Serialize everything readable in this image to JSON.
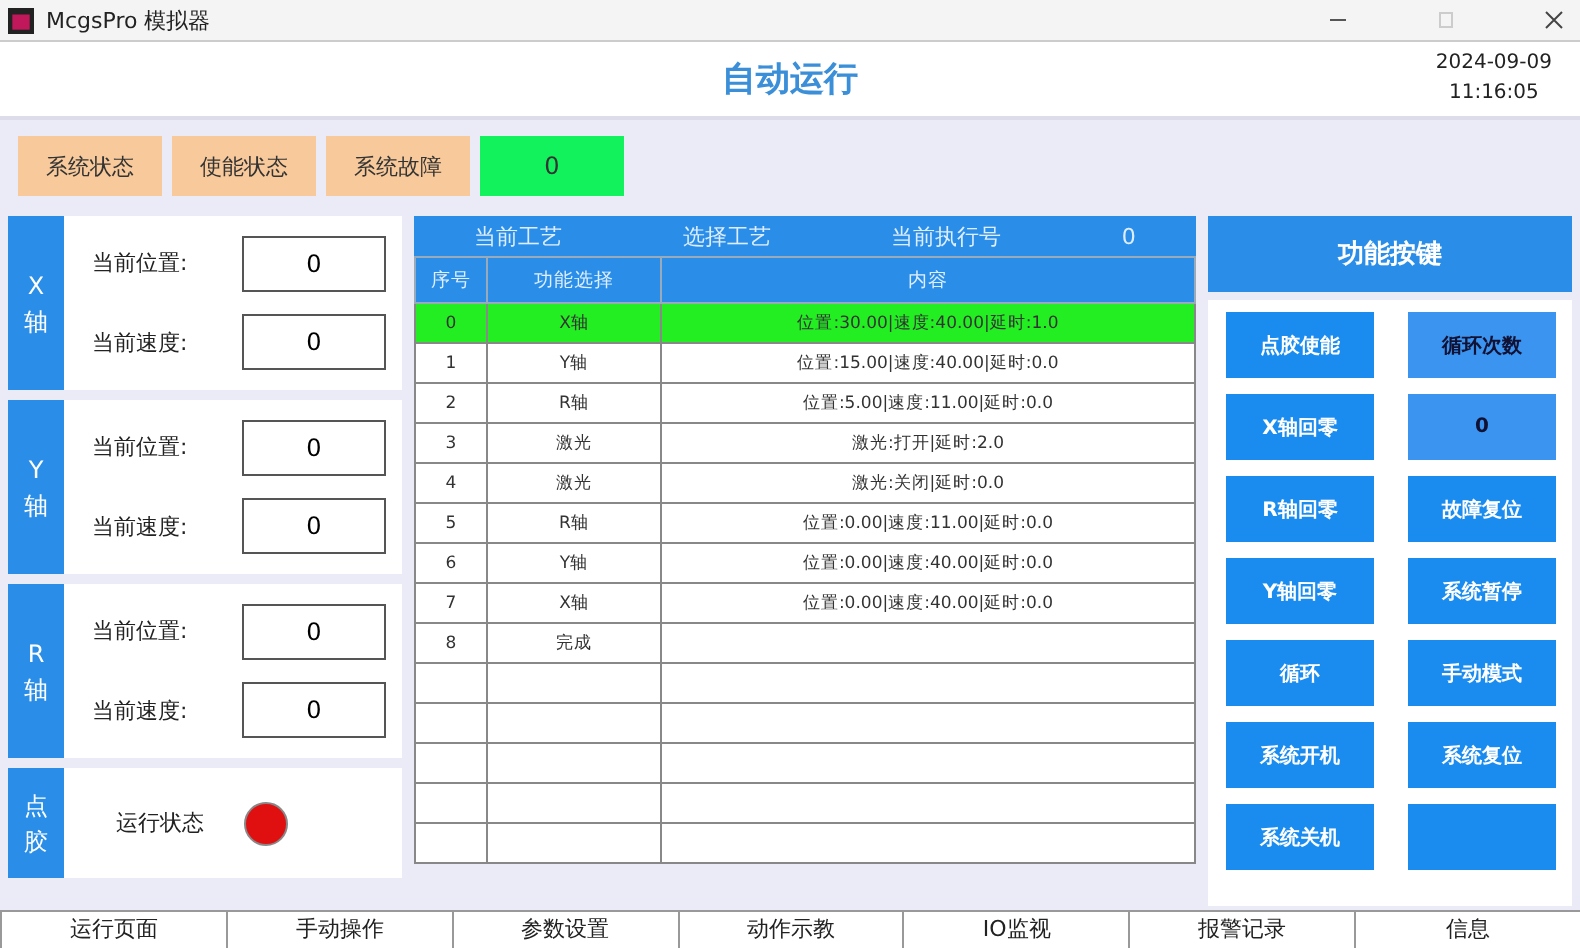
{
  "window": {
    "title": "McgsPro 模拟器"
  },
  "header": {
    "title": "自动运行",
    "date": "2024-09-09",
    "time": "11:16:05"
  },
  "status_buttons": [
    "系统状态",
    "使能状态",
    "系统故障"
  ],
  "status_value": "0",
  "axes": [
    {
      "name": "X轴",
      "fields": [
        {
          "label": "当前位置:",
          "value": "0"
        },
        {
          "label": "当前速度:",
          "value": "0"
        }
      ]
    },
    {
      "name": "Y轴",
      "fields": [
        {
          "label": "当前位置:",
          "value": "0"
        },
        {
          "label": "当前速度:",
          "value": "0"
        }
      ]
    },
    {
      "name": "R轴",
      "fields": [
        {
          "label": "当前位置:",
          "value": "0"
        },
        {
          "label": "当前速度:",
          "value": "0"
        }
      ]
    }
  ],
  "dispense": {
    "name": "点胶",
    "label": "运行状态",
    "running": true
  },
  "process": {
    "current_label": "当前工艺",
    "select_label": "选择工艺",
    "exec_label": "当前执行号",
    "exec_value": "0"
  },
  "table": {
    "columns": [
      "序号",
      "功能选择",
      "内容"
    ],
    "rows": [
      {
        "cells": [
          "0",
          "X轴",
          "位置:30.00|速度:40.00|延时:1.0"
        ],
        "selected": true
      },
      {
        "cells": [
          "1",
          "Y轴",
          "位置:15.00|速度:40.00|延时:0.0"
        ],
        "selected": false
      },
      {
        "cells": [
          "2",
          "R轴",
          "位置:5.00|速度:11.00|延时:0.0"
        ],
        "selected": false
      },
      {
        "cells": [
          "3",
          "激光",
          "激光:打开|延时:2.0"
        ],
        "selected": false
      },
      {
        "cells": [
          "4",
          "激光",
          "激光:关闭|延时:0.0"
        ],
        "selected": false
      },
      {
        "cells": [
          "5",
          "R轴",
          "位置:0.00|速度:11.00|延时:0.0"
        ],
        "selected": false
      },
      {
        "cells": [
          "6",
          "Y轴",
          "位置:0.00|速度:40.00|延时:0.0"
        ],
        "selected": false
      },
      {
        "cells": [
          "7",
          "X轴",
          "位置:0.00|速度:40.00|延时:0.0"
        ],
        "selected": false
      },
      {
        "cells": [
          "8",
          "完成"
        ],
        "selected": false
      }
    ]
  },
  "function_panel": {
    "title": "功能按键",
    "buttons": [
      {
        "kind": "button",
        "label": "点胶使能"
      },
      {
        "kind": "label",
        "label": "循环次数"
      },
      {
        "kind": "button",
        "label": "X轴回零"
      },
      {
        "kind": "value",
        "label": "0"
      },
      {
        "kind": "button",
        "label": "R轴回零"
      },
      {
        "kind": "button",
        "label": "故障复位"
      },
      {
        "kind": "button",
        "label": "Y轴回零"
      },
      {
        "kind": "button",
        "label": "系统暂停"
      },
      {
        "kind": "button",
        "label": "循环"
      },
      {
        "kind": "button",
        "label": "手动模式"
      },
      {
        "kind": "button",
        "label": "系统开机"
      },
      {
        "kind": "button",
        "label": "系统复位"
      },
      {
        "kind": "button",
        "label": "系统关机"
      },
      {
        "kind": "button"
      }
    ]
  },
  "nav": [
    "运行页面",
    "手动操作",
    "参数设置",
    "动作示教",
    "IO监视",
    "报警记录",
    "信息"
  ]
}
